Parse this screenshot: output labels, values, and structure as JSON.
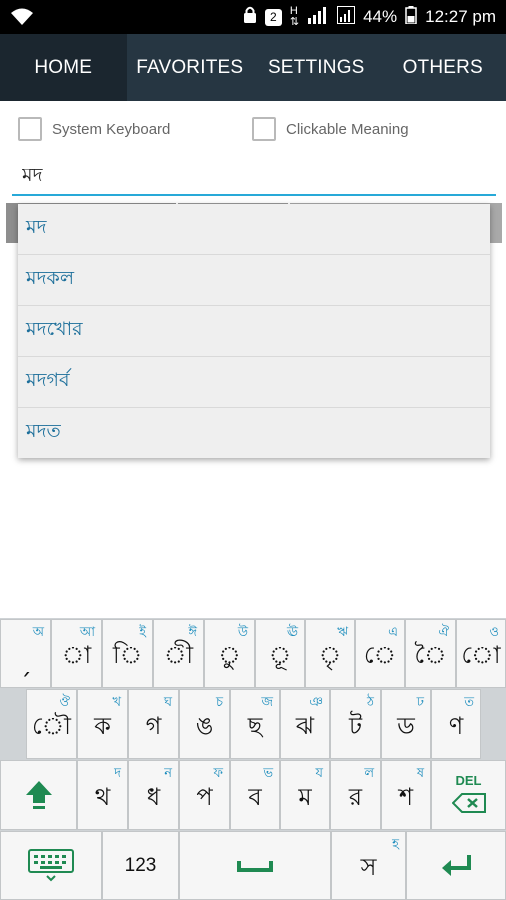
{
  "status_bar": {
    "battery": "44%",
    "time": "12:27 pm",
    "notification_badge": "2"
  },
  "nav": {
    "tabs": [
      {
        "label": "HOME"
      },
      {
        "label": "FAVORITES"
      },
      {
        "label": "SETTINGS"
      },
      {
        "label": "OTHERS"
      }
    ]
  },
  "options": {
    "system_keyboard": "System Keyboard",
    "clickable_meaning": "Clickable Meaning"
  },
  "search": {
    "value": "মদ"
  },
  "suggestions": [
    "মদ",
    "মদকল",
    "মদখোর",
    "মদগর্ব",
    "মদত"
  ],
  "keyboard": {
    "row1": [
      {
        "hint": "অ",
        "main": "ˏ"
      },
      {
        "hint": "আ",
        "main": "া"
      },
      {
        "hint": "ই",
        "main": "ি"
      },
      {
        "hint": "ঈ",
        "main": "ী"
      },
      {
        "hint": "উ",
        "main": "ু"
      },
      {
        "hint": "ঊ",
        "main": "ূ"
      },
      {
        "hint": "ঋ",
        "main": "ৃ"
      },
      {
        "hint": "এ",
        "main": "ে"
      },
      {
        "hint": "ঐ",
        "main": "ৈ"
      },
      {
        "hint": "ও",
        "main": "ো"
      }
    ],
    "row2": [
      {
        "hint": "ঔ",
        "main": "ৌ"
      },
      {
        "hint": "খ",
        "main": "ক"
      },
      {
        "hint": "ঘ",
        "main": "গ"
      },
      {
        "hint": "চ",
        "main": "ঙ"
      },
      {
        "hint": "জ",
        "main": "ছ"
      },
      {
        "hint": "ঞ",
        "main": "ঝ"
      },
      {
        "hint": "ঠ",
        "main": "ট"
      },
      {
        "hint": "ঢ",
        "main": "ড"
      },
      {
        "hint": "ত",
        "main": "ণ"
      }
    ],
    "row3": [
      {
        "hint": "দ",
        "main": "থ"
      },
      {
        "hint": "ন",
        "main": "ধ"
      },
      {
        "hint": "ফ",
        "main": "প"
      },
      {
        "hint": "ভ",
        "main": "ব"
      },
      {
        "hint": "য",
        "main": "ম"
      },
      {
        "hint": "ল",
        "main": "র"
      },
      {
        "hint": "ষ",
        "main": "শ"
      }
    ],
    "del_label": "DEL",
    "numbers_label": "123",
    "last_key": {
      "hint": "হ",
      "main": "স"
    },
    "accent_color": "#1f8a52"
  }
}
